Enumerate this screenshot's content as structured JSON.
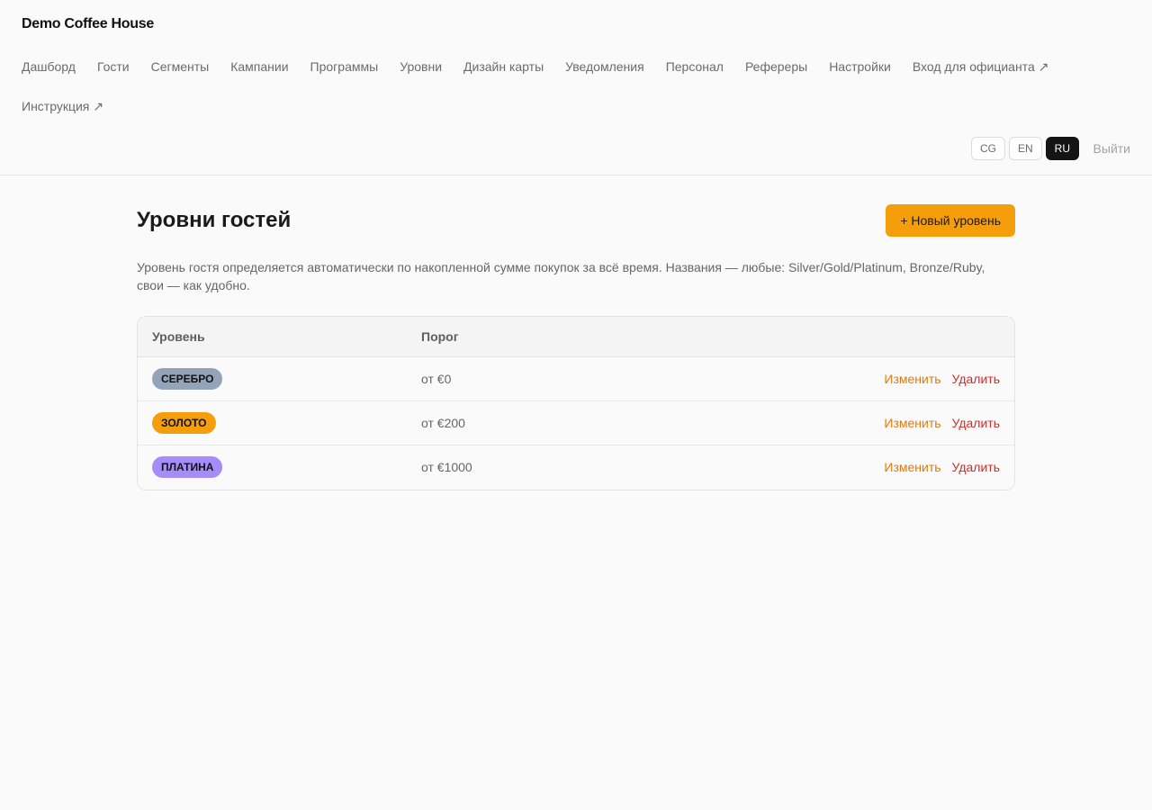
{
  "brand": "Demo Coffee House",
  "nav": [
    "Дашборд",
    "Гости",
    "Сегменты",
    "Кампании",
    "Программы",
    "Уровни",
    "Дизайн карты",
    "Уведомления",
    "Персонал",
    "Рефереры",
    "Настройки",
    "Вход для официанта ↗",
    "Инструкция ↗"
  ],
  "languages": [
    {
      "code": "CG",
      "active": false
    },
    {
      "code": "EN",
      "active": false
    },
    {
      "code": "RU",
      "active": true
    }
  ],
  "logout": "Выйти",
  "page": {
    "title": "Уровни гостей",
    "new_button": "+ Новый уровень",
    "description": "Уровень гостя определяется автоматически по накопленной сумме покупок за всё время. Названия — любые: Silver/Gold/Platinum, Bronze/Ruby, свои — как удобно."
  },
  "table": {
    "headers": {
      "level": "Уровень",
      "threshold": "Порог"
    },
    "rows": [
      {
        "name": "СЕРЕБРО",
        "color": "#94a3b8",
        "threshold": "от €0",
        "edit": "Изменить",
        "delete": "Удалить"
      },
      {
        "name": "ЗОЛОТО",
        "color": "#f59e0b",
        "threshold": "от €200",
        "edit": "Изменить",
        "delete": "Удалить"
      },
      {
        "name": "ПЛАТИНА",
        "color": "#a78bfa",
        "threshold": "от €1000",
        "edit": "Изменить",
        "delete": "Удалить"
      }
    ]
  },
  "colors": {
    "accent": "#f59e0b",
    "edit": "#e07a10",
    "delete": "#dc2626"
  }
}
